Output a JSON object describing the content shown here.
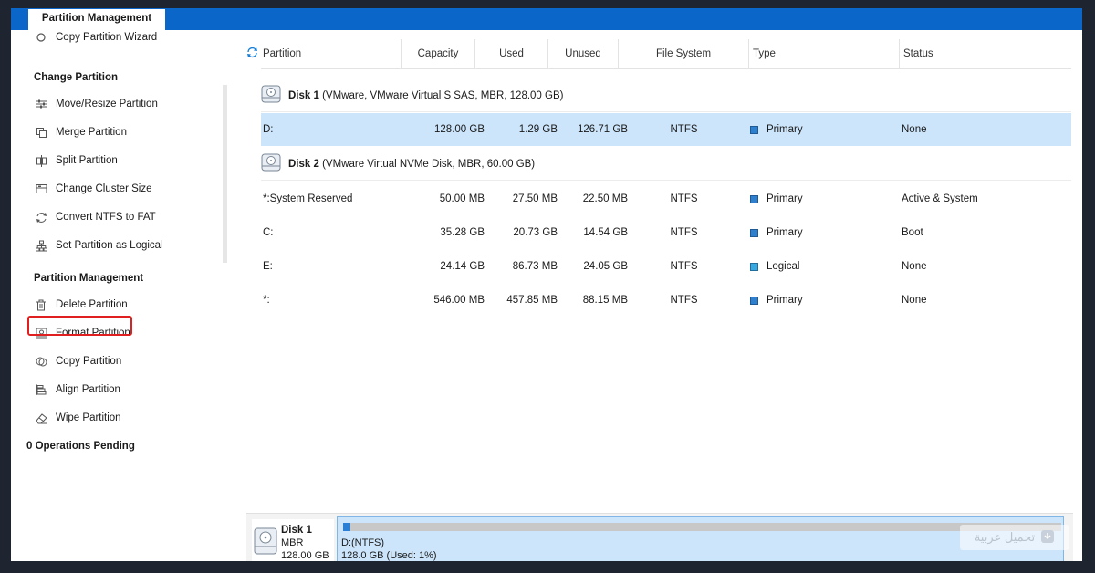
{
  "window": {
    "tab_title": "Partition Management"
  },
  "sidebar": {
    "top_item": "Copy Partition Wizard",
    "change_partition_heading": "Change Partition",
    "change_items": [
      {
        "label": "Move/Resize Partition",
        "icon": "sliders-icon"
      },
      {
        "label": "Merge Partition",
        "icon": "merge-icon"
      },
      {
        "label": "Split Partition",
        "icon": "split-icon"
      },
      {
        "label": "Change Cluster Size",
        "icon": "cluster-icon"
      },
      {
        "label": "Convert NTFS to FAT",
        "icon": "convert-icon"
      },
      {
        "label": "Set Partition as Logical",
        "icon": "hierarchy-icon"
      }
    ],
    "management_heading": "Partition Management",
    "management_items": [
      {
        "label": "Delete Partition",
        "icon": "trash-icon"
      },
      {
        "label": "Format Partition",
        "icon": "format-icon"
      },
      {
        "label": "Copy Partition",
        "icon": "copy-icon"
      },
      {
        "label": "Align Partition",
        "icon": "align-icon"
      },
      {
        "label": "Wipe Partition",
        "icon": "eraser-icon"
      }
    ],
    "pending": "0 Operations Pending"
  },
  "table": {
    "headers": [
      "Partition",
      "Capacity",
      "Used",
      "Unused",
      "File System",
      "Type",
      "Status"
    ],
    "disk1": {
      "name": "Disk 1",
      "desc": "(VMware, VMware Virtual S SAS, MBR, 128.00 GB)"
    },
    "disk1_rows": [
      {
        "partition": "D:",
        "capacity": "128.00 GB",
        "used": "1.29 GB",
        "unused": "126.71 GB",
        "fs": "NTFS",
        "type": "Primary",
        "status": "None"
      }
    ],
    "disk2": {
      "name": "Disk 2",
      "desc": "(VMware Virtual NVMe Disk, MBR, 60.00 GB)"
    },
    "disk2_rows": [
      {
        "partition": "*:System Reserved",
        "capacity": "50.00 MB",
        "used": "27.50 MB",
        "unused": "22.50 MB",
        "fs": "NTFS",
        "type": "Primary",
        "status": "Active & System"
      },
      {
        "partition": "C:",
        "capacity": "35.28 GB",
        "used": "20.73 GB",
        "unused": "14.54 GB",
        "fs": "NTFS",
        "type": "Primary",
        "status": "Boot"
      },
      {
        "partition": "E:",
        "capacity": "24.14 GB",
        "used": "86.73 MB",
        "unused": "24.05 GB",
        "fs": "NTFS",
        "type": "Logical",
        "status": "None"
      },
      {
        "partition": "*:",
        "capacity": "546.00 MB",
        "used": "457.85 MB",
        "unused": "88.15 MB",
        "fs": "NTFS",
        "type": "Primary",
        "status": "None"
      }
    ]
  },
  "diskmap": {
    "name": "Disk 1",
    "style": "MBR",
    "size": "128.00 GB",
    "part_label": "D:(NTFS)",
    "part_detail": "128.0 GB (Used: 1%)",
    "used_fraction": 0.01
  },
  "watermark": "تحميل عربية",
  "colors": {
    "accent": "#0a67c9",
    "selected_row": "#cce5fb",
    "primary_type": "#2f7fcf",
    "logical_type": "#3aa8e0",
    "highlight": "#e02020"
  }
}
